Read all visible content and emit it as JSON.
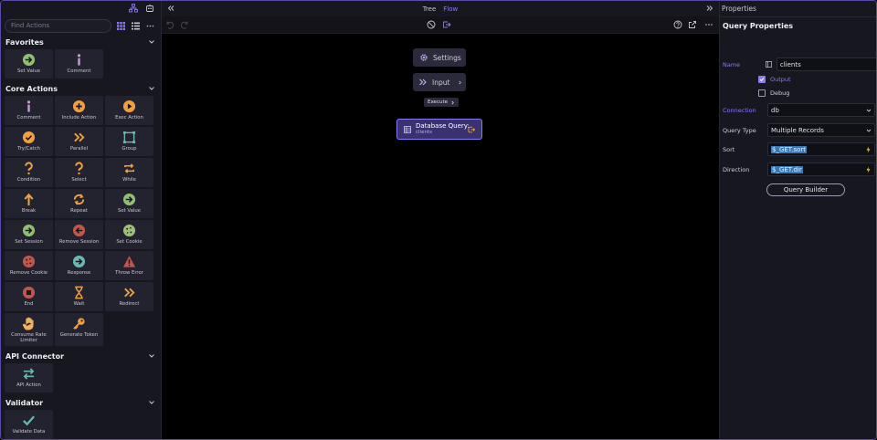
{
  "left_panel": {
    "search_placeholder": "Find Actions",
    "sections": [
      {
        "title": "Favorites",
        "items": [
          {
            "label": "Set Value",
            "icon": "arrow-right-icon"
          },
          {
            "label": "Comment",
            "icon": "info-icon"
          }
        ]
      },
      {
        "title": "Core Actions",
        "items": [
          {
            "label": "Comment",
            "icon": "info-icon"
          },
          {
            "label": "Include Action",
            "icon": "plus-circle-icon"
          },
          {
            "label": "Exec Action",
            "icon": "play-icon"
          },
          {
            "label": "Try/Catch",
            "icon": "check-circle-icon"
          },
          {
            "label": "Parallel",
            "icon": "double-chevron-icon"
          },
          {
            "label": "Group",
            "icon": "group-icon"
          },
          {
            "label": "Condition",
            "icon": "question-icon"
          },
          {
            "label": "Select",
            "icon": "question-icon"
          },
          {
            "label": "While",
            "icon": "loop-icon"
          },
          {
            "label": "Break",
            "icon": "arrow-up-icon"
          },
          {
            "label": "Repeat",
            "icon": "repeat-icon"
          },
          {
            "label": "Set Value",
            "icon": "arrow-right-icon"
          },
          {
            "label": "Set Session",
            "icon": "arrow-right-icon"
          },
          {
            "label": "Remove Session",
            "icon": "arrow-left-icon"
          },
          {
            "label": "Set Cookie",
            "icon": "cookie-icon"
          },
          {
            "label": "Remove Cookie",
            "icon": "cookie-icon"
          },
          {
            "label": "Response",
            "icon": "arrow-right-icon"
          },
          {
            "label": "Throw Error",
            "icon": "warning-icon"
          },
          {
            "label": "End",
            "icon": "stop-icon"
          },
          {
            "label": "Wait",
            "icon": "hourglass-icon"
          },
          {
            "label": "Redirect",
            "icon": "double-chevron-icon"
          },
          {
            "label": "Consume Rate Limiter",
            "icon": "hand-icon"
          },
          {
            "label": "Generate Token",
            "icon": "key-icon"
          }
        ]
      },
      {
        "title": "API Connector",
        "items": [
          {
            "label": "API Action",
            "icon": "swap-icon"
          }
        ]
      },
      {
        "title": "Validator",
        "items": [
          {
            "label": "Validate Data",
            "icon": "checkmark-icon"
          }
        ]
      }
    ]
  },
  "center": {
    "tab_tree": "Tree",
    "tab_flow": "Flow",
    "nodes": {
      "settings": "Settings",
      "input": "Input",
      "execute": "Execute",
      "db_title": "Database Query:",
      "db_sub": "clients"
    }
  },
  "right_panel": {
    "title": "Properties",
    "subtitle": "Query Properties",
    "name_label": "Name",
    "name_value": "clients",
    "output_label": "Output",
    "debug_label": "Debug",
    "connection_label": "Connection",
    "connection_value": "db",
    "query_type_label": "Query Type",
    "query_type_value": "Multiple Records",
    "sort_label": "Sort",
    "sort_value": "$_GET.sort",
    "direction_label": "Direction",
    "direction_value": "$_GET.dir",
    "query_builder_label": "Query Builder"
  },
  "colors": {
    "accent": "#8c7bf0",
    "green": "#8fbf70",
    "orange": "#f0a040",
    "red": "#c0584a",
    "teal": "#6ab8b0"
  }
}
